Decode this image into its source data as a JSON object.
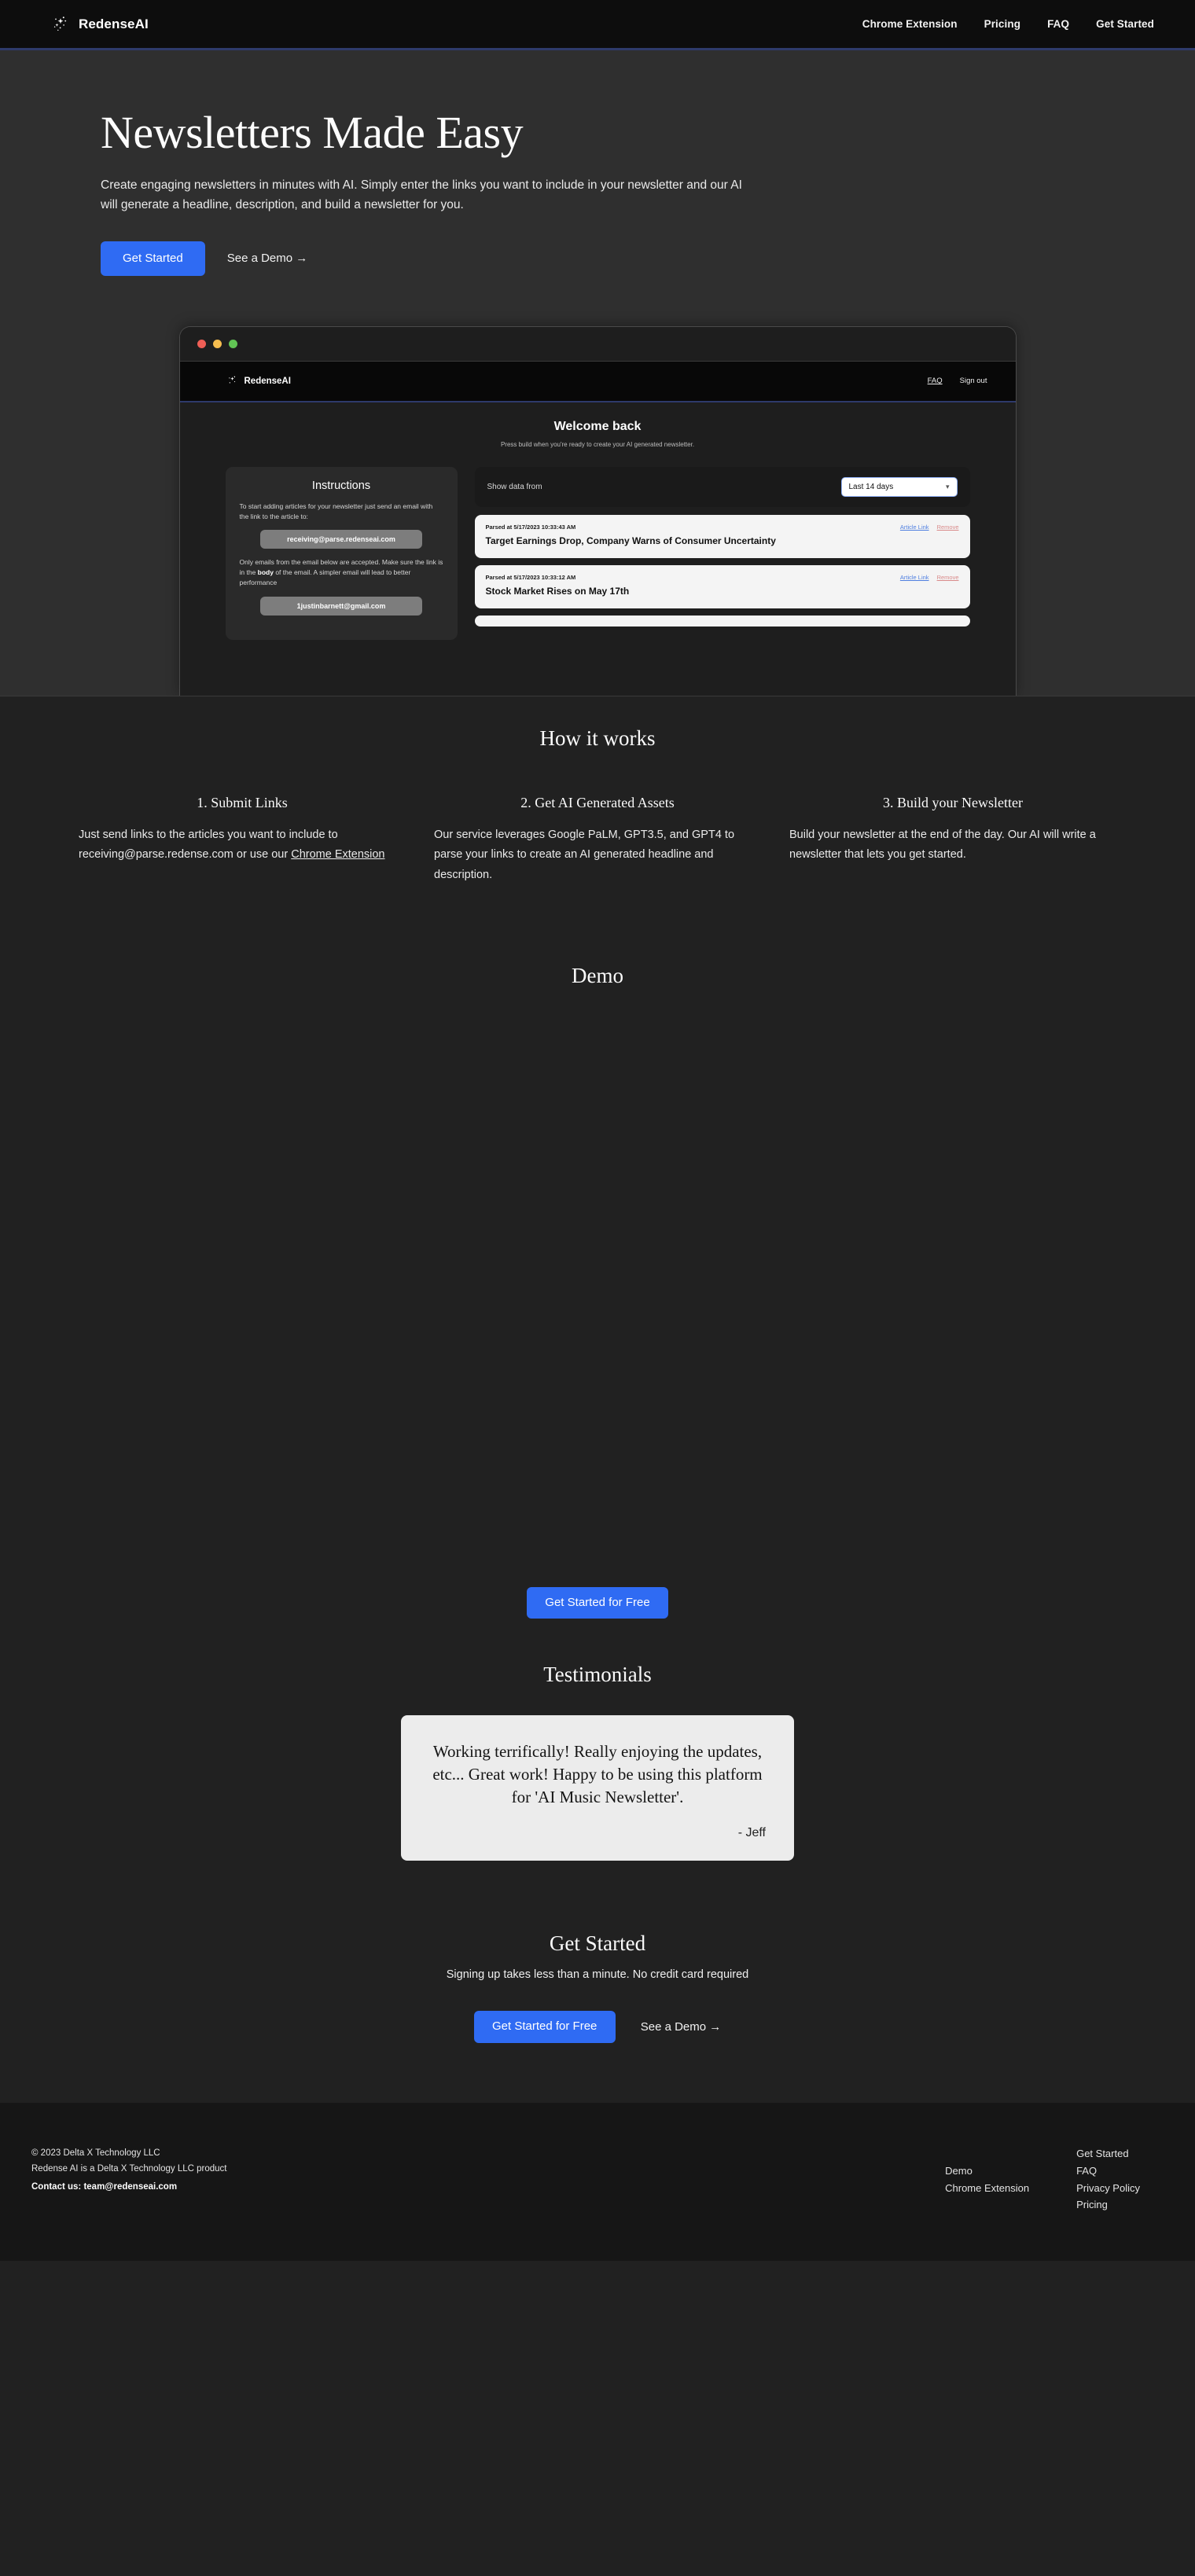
{
  "brand": {
    "name": "RedenseAI",
    "logo_icon": "sparkle-icon"
  },
  "nav": {
    "links": [
      {
        "label": "Chrome Extension"
      },
      {
        "label": "Pricing"
      },
      {
        "label": "FAQ"
      },
      {
        "label": "Get Started"
      }
    ]
  },
  "hero": {
    "title": "Newsletters Made Easy",
    "subtitle": "Create engaging newsletters in minutes with AI. Simply enter the links you want to include in your newsletter and our AI will generate a headline, description, and build a newsletter for you.",
    "primary_cta": "Get Started",
    "secondary_cta": "See a Demo →"
  },
  "mockup": {
    "window_dots": [
      "red",
      "yellow",
      "green"
    ],
    "app_brand": "RedenseAI",
    "app_nav": [
      {
        "label": "FAQ",
        "underline": true
      },
      {
        "label": "Sign out",
        "underline": false
      }
    ],
    "welcome_title": "Welcome back",
    "welcome_sub": "Press build when you're ready to create your AI generated newsletter.",
    "instructions": {
      "heading": "Instructions",
      "p1": "To start adding articles for your newsletter just send an email with the link to the article to:",
      "email_receiving": "receiving@parse.redenseai.com",
      "p2_a": "Only emails from the email below are accepted. Make sure the link is in the ",
      "p2_b": "body",
      "p2_c": " of the email. A simpler email will lead to better performance",
      "email_user": "1justinbarnett@gmail.com"
    },
    "filter": {
      "label": "Show data from",
      "selected": "Last 14 days",
      "chevron": "chevron-down-icon"
    },
    "articles": [
      {
        "parsed": "Parsed at 5/17/2023 10:33:43 AM",
        "link_label": "Article Link",
        "remove_label": "Remove",
        "title": "Target Earnings Drop, Company Warns of Consumer Uncertainty"
      },
      {
        "parsed": "Parsed at 5/17/2023 10:33:12 AM",
        "link_label": "Article Link",
        "remove_label": "Remove",
        "title": "Stock Market Rises on May 17th"
      }
    ]
  },
  "how_it_works": {
    "title": "How it works",
    "steps": [
      {
        "heading": "1. Submit Links",
        "body_before": "Just send links to the articles you want to include to receiving@parse.redense.com or use our ",
        "link": "Chrome Extension",
        "body_after": ""
      },
      {
        "heading": "2. Get AI Generated Assets",
        "body_before": "Our service leverages Google PaLM, GPT3.5, and GPT4 to parse your links to create an AI generated headline and description.",
        "link": "",
        "body_after": ""
      },
      {
        "heading": "3. Build your Newsletter",
        "body_before": "Build your newsletter at the end of the day. Our AI will write a newsletter that lets you get started.",
        "link": "",
        "body_after": ""
      }
    ]
  },
  "demo": {
    "title": "Demo",
    "cta": "Get Started for Free"
  },
  "testimonials": {
    "title": "Testimonials",
    "items": [
      {
        "quote": "Working terrifically! Really enjoying the updates, etc... Great work! Happy to be using this platform for 'AI Music Newsletter'.",
        "author": "- Jeff"
      }
    ]
  },
  "get_started": {
    "title": "Get Started",
    "subtitle": "Signing up takes less than a minute. No credit card required",
    "primary_cta": "Get Started for Free",
    "secondary_cta": "See a Demo →"
  },
  "footer": {
    "copyright": "© 2023 Delta X Technology LLC",
    "product_line": "Redense AI is a Delta X Technology LLC product",
    "contact": "Contact us: team@redenseai.com",
    "col_a": [
      {
        "label": "Demo"
      },
      {
        "label": "Chrome Extension"
      }
    ],
    "col_b": [
      {
        "label": "Get Started"
      },
      {
        "label": "FAQ"
      },
      {
        "label": "Privacy Policy"
      },
      {
        "label": "Pricing"
      }
    ]
  },
  "colors": {
    "accent": "#2f6bf3",
    "hero_bg": "#2f2f2f",
    "page_bg": "#212121",
    "nav_bg": "#0d0d0d",
    "footer_bg": "#161616",
    "nav_underline": "#2e3a6b"
  }
}
